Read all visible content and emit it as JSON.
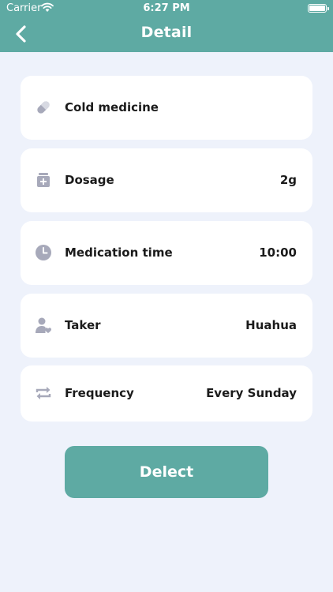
{
  "status_bar": {
    "carrier": "Carrier",
    "time": "6:27 PM"
  },
  "header": {
    "title": "Detail"
  },
  "details": [
    {
      "icon": "pill-icon",
      "label": "Cold medicine",
      "value": ""
    },
    {
      "icon": "medicine-bottle-icon",
      "label": "Dosage",
      "value": "2g"
    },
    {
      "icon": "clock-icon",
      "label": "Medication time",
      "value": "10:00"
    },
    {
      "icon": "person-icon",
      "label": "Taker",
      "value": "Huahua"
    },
    {
      "icon": "repeat-icon",
      "label": "Frequency",
      "value": "Every Sunday"
    }
  ],
  "actions": {
    "delete_label": "Delect"
  },
  "colors": {
    "accent": "#5eaaa3",
    "background": "#eef2fb",
    "icon": "#a7a9ba"
  }
}
